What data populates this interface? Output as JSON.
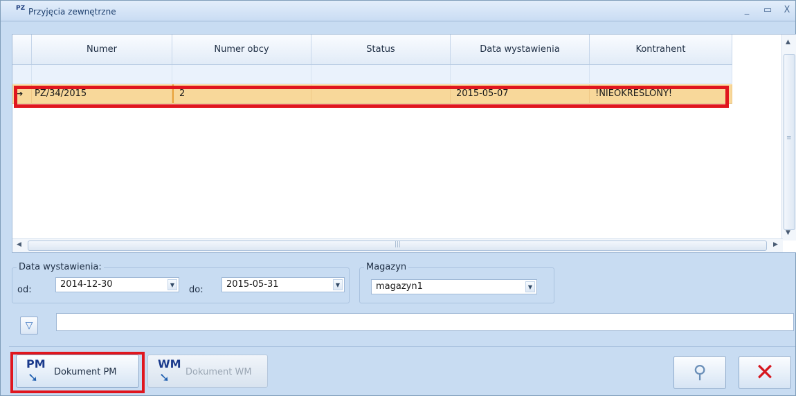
{
  "window": {
    "icon_text": "PZ",
    "title": "Przyjęcia zewnętrzne",
    "minimize": "_",
    "maximize": "▭",
    "close": "X"
  },
  "grid": {
    "columns": [
      "Numer",
      "Numer obcy",
      "Status",
      "Data wystawienia",
      "Kontrahent"
    ],
    "rows": [
      {
        "indicator": "➔",
        "numer": "PZ/34/2015",
        "numer_obcy": "2",
        "status": "",
        "data": "2015-05-07",
        "kontrahent": "!NIEOKREŚLONY!"
      }
    ],
    "selected_row": 0,
    "highlight_color": "#e0161e",
    "selection_color": "#f8d89a"
  },
  "filters": {
    "date_group_title": "Data wystawienia:",
    "od_label": "od:",
    "od_value": "2014-12-30",
    "do_label": "do:",
    "do_value": "2015-05-31",
    "magazyn_group_title": "Magazyn",
    "magazyn_value": "magazyn1",
    "search_value": "",
    "filter_icon": "funnel-icon"
  },
  "actions": {
    "pm_code": "PM",
    "pm_label": "Dokument PM",
    "wm_code": "WM",
    "wm_label": "Dokument WM",
    "search_icon": "magnifier-icon",
    "close_icon": "red-x-icon"
  }
}
